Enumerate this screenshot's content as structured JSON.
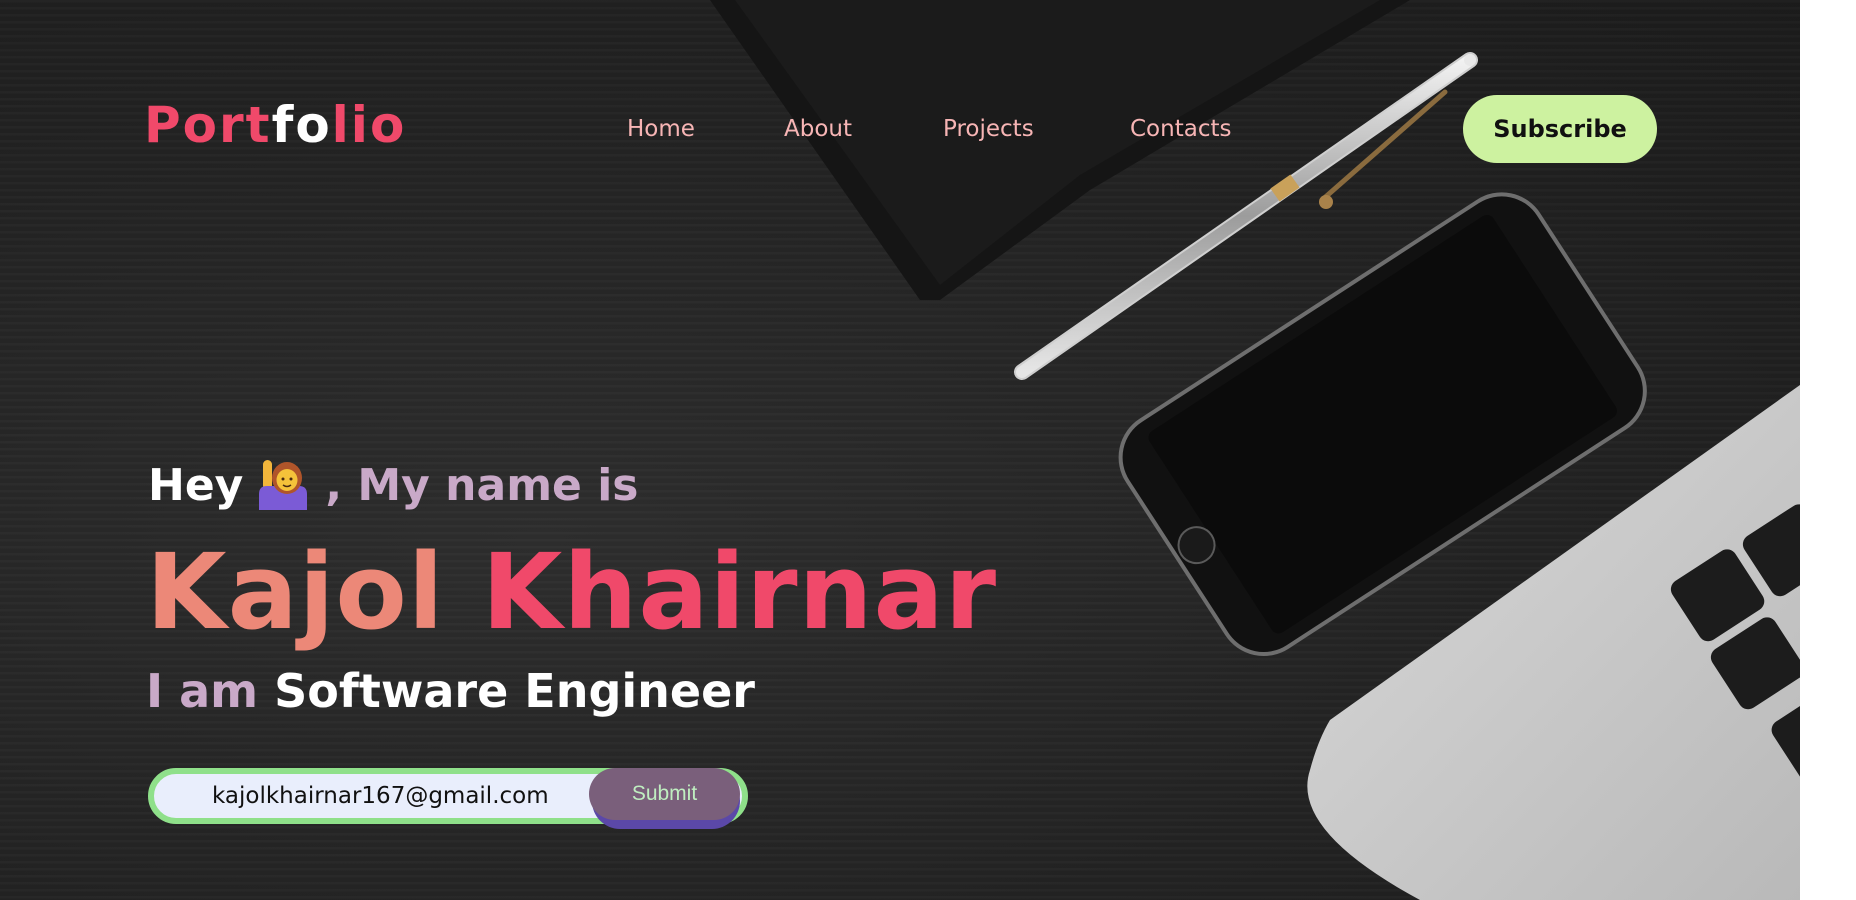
{
  "header": {
    "logo": {
      "part1": "Port",
      "part2": "fo",
      "part3": "lio"
    },
    "nav": [
      {
        "label": "Home"
      },
      {
        "label": "About"
      },
      {
        "label": "Projects"
      },
      {
        "label": "Contacts"
      }
    ],
    "subscribe_label": "Subscribe"
  },
  "hero": {
    "greeting_hey": "Hey",
    "greeting_emoji": "person-raising-hand-emoji",
    "greeting_rest": ", My name is",
    "first_name": "Kajol",
    "last_name": "Khairnar",
    "role_prefix": "I am",
    "role": "Software Engineer"
  },
  "form": {
    "email_value": "kajolkhairnar167@gmail.com",
    "submit_label": "Submit"
  },
  "colors": {
    "accent_pink": "#f0496a",
    "accent_salmon": "#ec8878",
    "lilac": "#c9a9c8",
    "subscribe_bg": "#cdf2a0",
    "input_border": "#8fe08a",
    "submit_bg": "#7a5f7b",
    "nav_text": "#f7b5b5"
  }
}
